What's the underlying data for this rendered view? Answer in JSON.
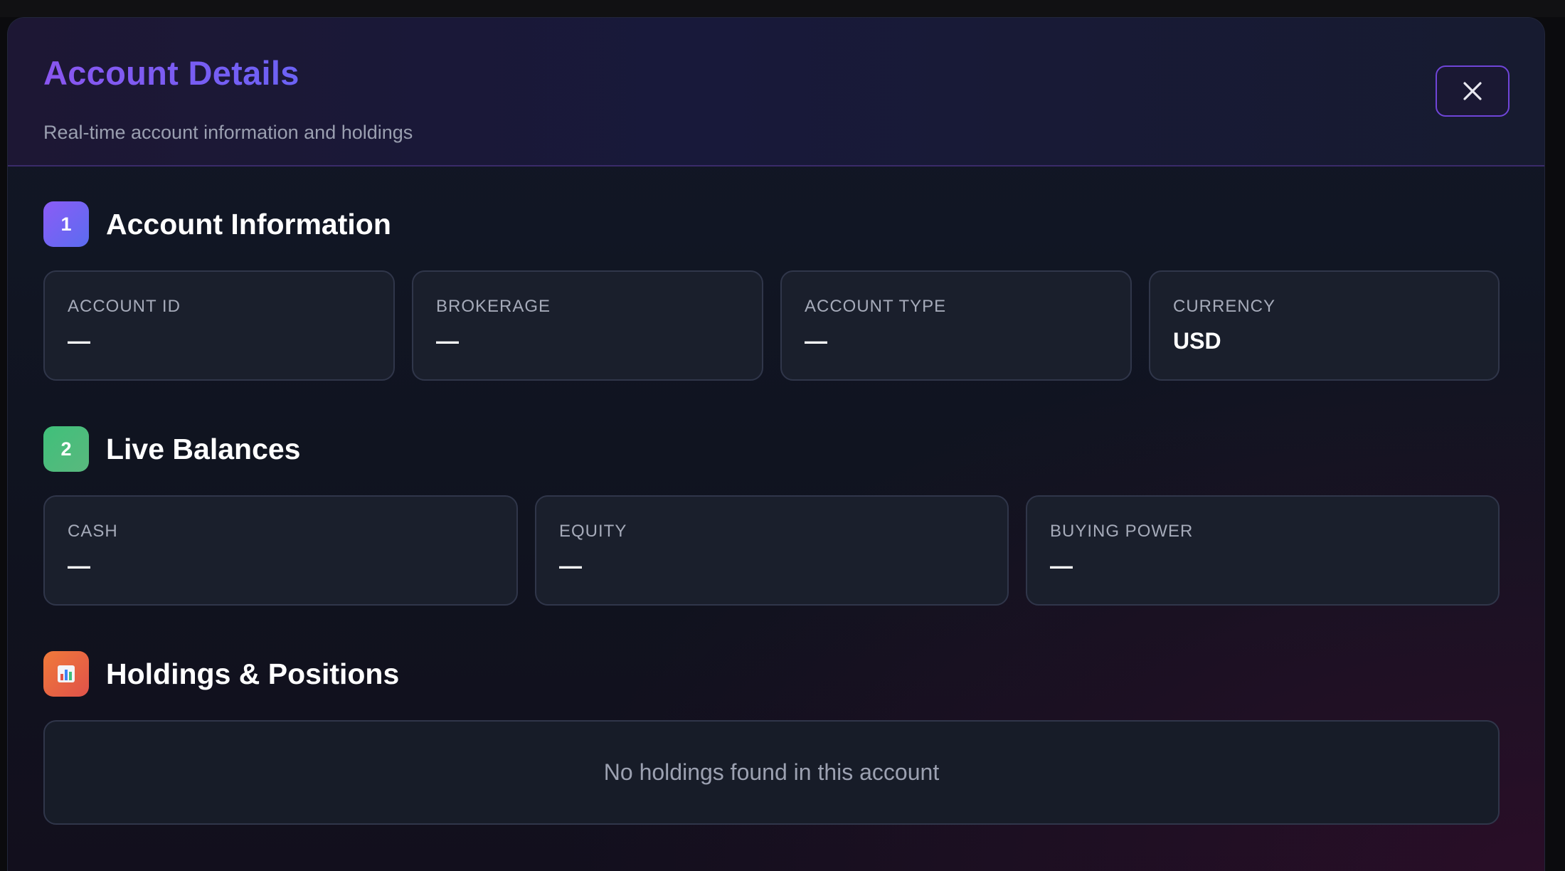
{
  "header": {
    "title": "Account Details",
    "subtitle": "Real-time account information and holdings",
    "close_icon": "close-icon"
  },
  "sections": {
    "account_info": {
      "badge": "1",
      "title": "Account Information",
      "cards": [
        {
          "label": "ACCOUNT ID",
          "value": "—"
        },
        {
          "label": "BROKERAGE",
          "value": "—"
        },
        {
          "label": "ACCOUNT TYPE",
          "value": "—"
        },
        {
          "label": "CURRENCY",
          "value": "USD"
        }
      ]
    },
    "balances": {
      "badge": "2",
      "title": "Live Balances",
      "cards": [
        {
          "label": "CASH",
          "value": "—"
        },
        {
          "label": "EQUITY",
          "value": "—"
        },
        {
          "label": "BUYING POWER",
          "value": "—"
        }
      ]
    },
    "holdings": {
      "badge_icon": "bar-chart-icon",
      "title": "Holdings & Positions",
      "empty_message": "No holdings found in this account"
    }
  },
  "colors": {
    "accent": "#8b5cf6",
    "badge_green": "#3fc07a",
    "badge_orange": "#f07a3a"
  }
}
